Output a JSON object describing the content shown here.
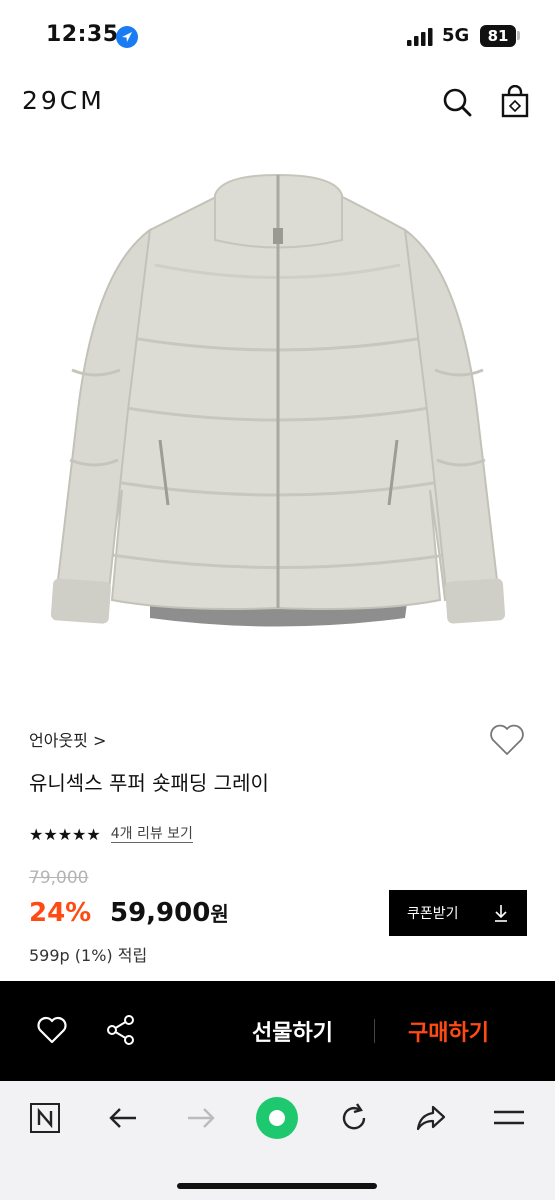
{
  "status_bar": {
    "time": "12:35",
    "network": "5G",
    "battery": "81"
  },
  "header": {
    "logo": "29CM",
    "icons": [
      "search-icon",
      "shopping-bag-icon"
    ]
  },
  "product": {
    "brand": "언아웃핏 >",
    "name": "유니섹스 푸퍼 숏패딩 그레이",
    "rating_stars": "★★★★★",
    "rating": 5,
    "review_link": "4개 리뷰 보기",
    "original_price": "79,000",
    "discount": "24%",
    "sale_price": "59,900",
    "currency": "원",
    "points": "599p (1%) 적립",
    "coupon_label": "쿠폰받기"
  },
  "action_bar": {
    "gift_label": "선물하기",
    "buy_label": "구매하기"
  },
  "browser_toolbar": {
    "icons": [
      "naver-icon",
      "back-arrow-icon",
      "forward-arrow-icon",
      "naver-green-button-icon",
      "reload-icon",
      "share-icon",
      "menu-icon"
    ]
  },
  "colors": {
    "accent": "#ff4b12",
    "bar_background": "#000000",
    "toolbar_background": "#f2f2f4",
    "green": "#1ec800"
  }
}
